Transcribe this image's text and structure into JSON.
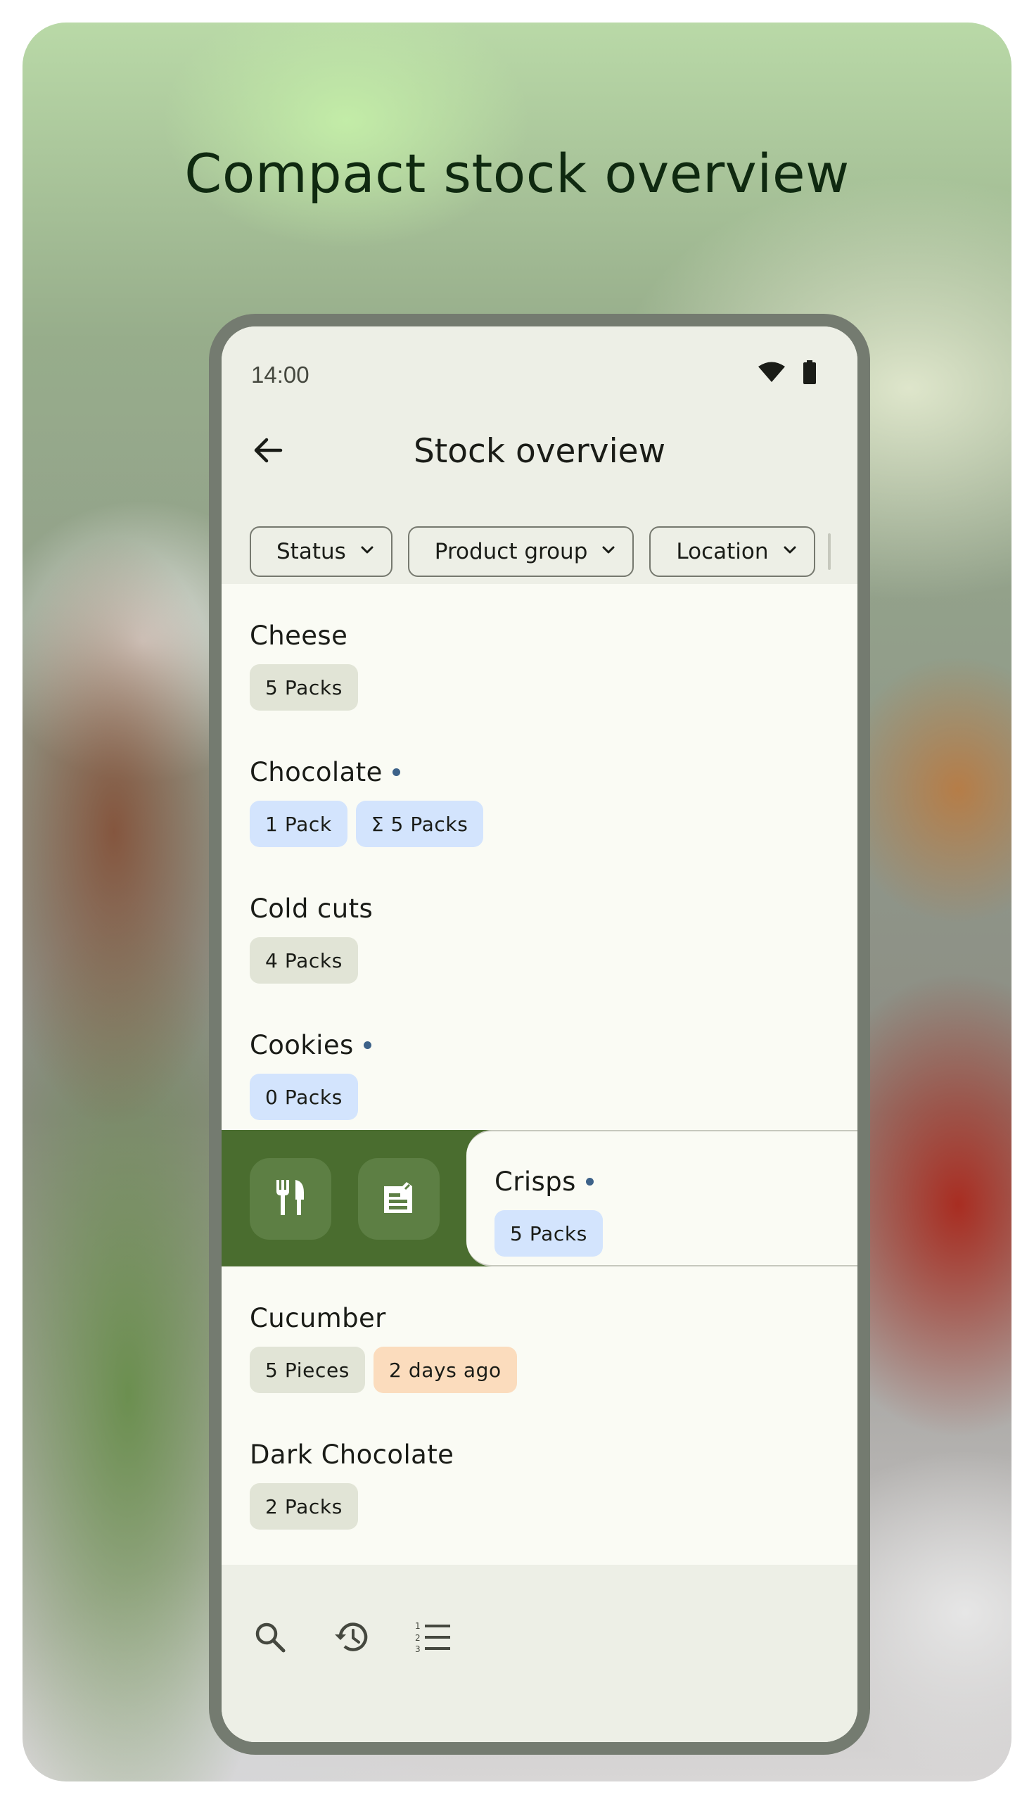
{
  "headline": "Compact stock overview",
  "status_bar": {
    "time": "14:00",
    "icons": [
      "wifi-icon",
      "battery-icon"
    ]
  },
  "app_bar": {
    "title": "Stock overview",
    "back_icon": "arrow-back-icon"
  },
  "filters": [
    {
      "label": "Status"
    },
    {
      "label": "Product group"
    },
    {
      "label": "Location"
    }
  ],
  "items": [
    {
      "name": "Cheese",
      "dot": false,
      "badges": [
        {
          "text": "5 Packs",
          "tone": "gray"
        }
      ]
    },
    {
      "name": "Chocolate",
      "dot": true,
      "badges": [
        {
          "text": "1 Pack",
          "tone": "blue"
        },
        {
          "text": "Σ 5 Packs",
          "tone": "blue"
        }
      ]
    },
    {
      "name": "Cold cuts",
      "dot": false,
      "badges": [
        {
          "text": "4 Packs",
          "tone": "gray"
        }
      ]
    },
    {
      "name": "Cookies",
      "dot": true,
      "badges": [
        {
          "text": "0 Packs",
          "tone": "blue"
        }
      ]
    },
    {
      "name": "Crisps",
      "dot": true,
      "swiped": true,
      "actions": [
        "consume-icon",
        "open-icon"
      ],
      "badges": [
        {
          "text": "5 Packs",
          "tone": "blue"
        }
      ]
    },
    {
      "name": "Cucumber",
      "dot": false,
      "badges": [
        {
          "text": "5 Pieces",
          "tone": "gray"
        },
        {
          "text": "2 days ago",
          "tone": "orange"
        }
      ]
    },
    {
      "name": "Dark Chocolate",
      "dot": false,
      "badges": [
        {
          "text": "2 Packs",
          "tone": "gray"
        }
      ]
    }
  ],
  "bottom_nav": [
    "search-icon",
    "history-icon",
    "list-numbered-icon"
  ],
  "colors": {
    "swipe_background": "#4a6d2f",
    "badge_gray": "#e1e4d6",
    "badge_blue": "#d3e4fd",
    "badge_orange": "#fbdcbd",
    "dot": "#3d6289"
  }
}
